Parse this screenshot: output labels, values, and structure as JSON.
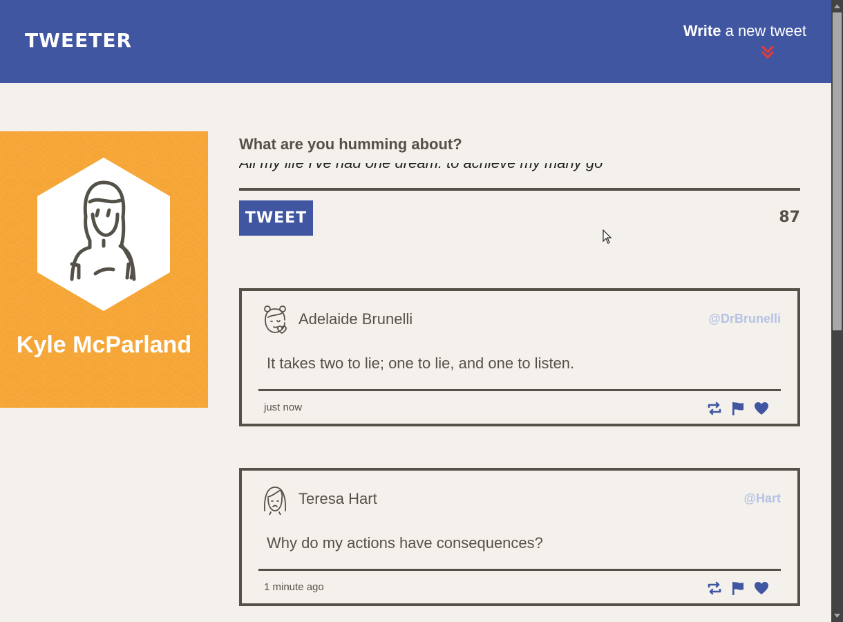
{
  "nav": {
    "brand": "TWEETER",
    "compose_bold": "Write",
    "compose_rest": " a new tweet"
  },
  "profile": {
    "name": "Kyle McParland"
  },
  "compose": {
    "label": "What are you humming about?",
    "value": "All my life I've had one dream: to achieve my many go",
    "button_label": "TWEET",
    "counter": "87"
  },
  "tweets": [
    {
      "name": "Adelaide Brunelli",
      "handle": "@DrBrunelli",
      "text": "It takes two to lie; one to lie, and one to listen.",
      "time": "just now"
    },
    {
      "name": "Teresa Hart",
      "handle": "@Hart",
      "text": "Why do my actions have consequences?",
      "time": "1 minute ago"
    }
  ],
  "colors": {
    "nav_bg": "#4056a1",
    "profile_bg": "#f5a637",
    "accent_red": "#e23b3b",
    "text": "#545149",
    "handle": "#b5c2e3",
    "background": "#f4f1ec"
  },
  "icons": {
    "chevrons": "double-chevron-down-icon",
    "retweet": "retweet-icon",
    "flag": "flag-icon",
    "like": "heart-icon"
  }
}
